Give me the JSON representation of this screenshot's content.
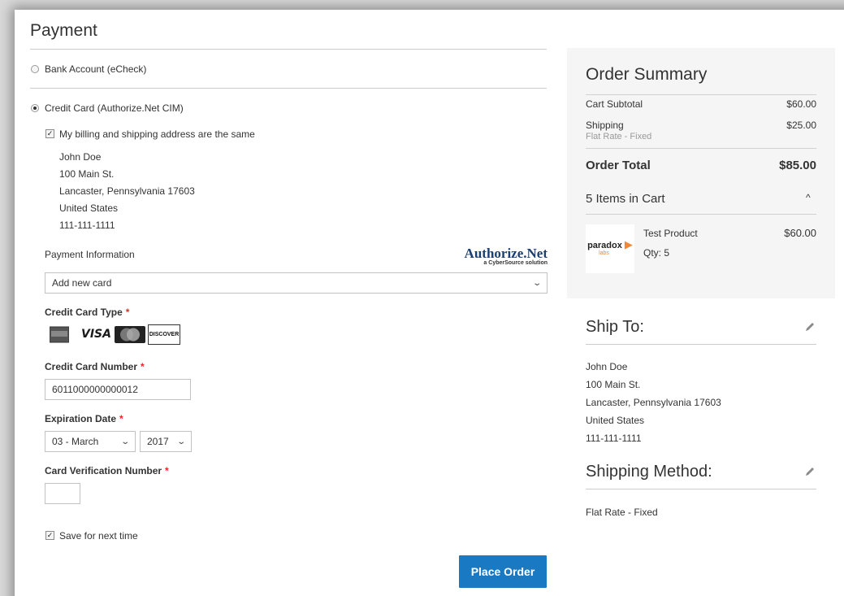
{
  "payment": {
    "title": "Payment",
    "methods": [
      {
        "label": "Bank Account (eCheck)",
        "selected": false
      },
      {
        "label": "Credit Card (Authorize.Net CIM)",
        "selected": true
      }
    ],
    "same_address_label": "My billing and shipping address are the same",
    "address": [
      "John Doe",
      "100 Main St.",
      "Lancaster, Pennsylvania 17603",
      "United States",
      "111-111-1111"
    ],
    "payment_info_label": "Payment Information",
    "logo": {
      "main": "Authorize.Net",
      "sub": "a CyberSource solution"
    },
    "card_select_value": "Add new card",
    "cc_type_label": "Credit Card Type",
    "cc_types": [
      "American Express",
      "VISA",
      "MasterCard",
      "DISCOVER"
    ],
    "cc_number_label": "Credit Card Number",
    "cc_number_value": "6011000000000012",
    "exp_label": "Expiration Date",
    "exp_month": "03 - March",
    "exp_year": "2017",
    "cvv_label": "Card Verification Number",
    "cvv_value": "",
    "required_mark": "*",
    "save_label": "Save for next time",
    "place_order": "Place Order"
  },
  "summary": {
    "title": "Order Summary",
    "subtotal_label": "Cart Subtotal",
    "subtotal_value": "$60.00",
    "shipping_label": "Shipping",
    "shipping_sub": "Flat Rate - Fixed",
    "shipping_value": "$25.00",
    "total_label": "Order Total",
    "total_value": "$85.00",
    "items_label": "5 Items in Cart",
    "product": {
      "name": "Test Product",
      "qty": "Qty: 5",
      "price": "$60.00",
      "thumb_text": "paradox",
      "thumb_sub": "labs"
    }
  },
  "ship_to": {
    "title": "Ship To:",
    "lines": [
      "John Doe",
      "100 Main St.",
      "Lancaster, Pennsylvania 17603",
      "United States",
      "111-111-1111"
    ]
  },
  "shipping_method": {
    "title": "Shipping Method:",
    "value": "Flat Rate - Fixed"
  },
  "colors": {
    "accent": "#1979c3",
    "required": "#e02b27",
    "summary_bg": "#f5f5f5"
  }
}
